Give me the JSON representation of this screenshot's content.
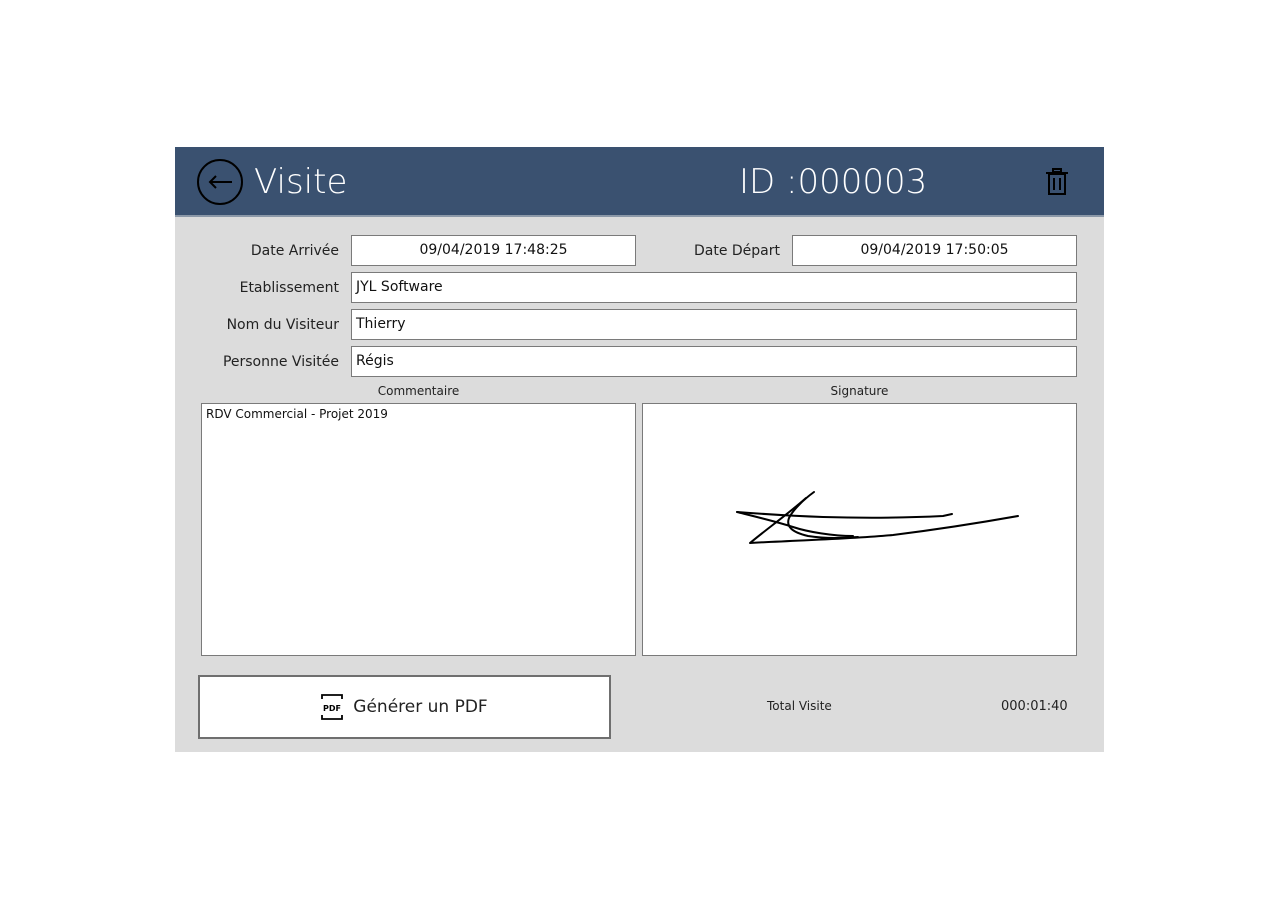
{
  "header": {
    "title": "Visite",
    "id_text": "ID :000003",
    "back_icon": "arrow-left-icon",
    "delete_icon": "trash-icon"
  },
  "form": {
    "date_arrivee_label": "Date Arrivée",
    "date_arrivee_value": "09/04/2019 17:48:25",
    "date_depart_label": "Date Départ",
    "date_depart_value": "09/04/2019 17:50:05",
    "etablissement_label": "Etablissement",
    "etablissement_value": "JYL Software",
    "visiteur_label": "Nom du Visiteur",
    "visiteur_value": "Thierry",
    "personne_label": "Personne Visitée",
    "personne_value": "Régis"
  },
  "commentaire": {
    "title": "Commentaire",
    "text": "RDV Commercial - Projet 2019"
  },
  "signature": {
    "title": "Signature"
  },
  "footer": {
    "pdf_button_label": "Générer un PDF",
    "pdf_icon": "pdf-icon",
    "pdf_icon_text": "PDF",
    "total_label": "Total Visite",
    "total_value": "000:01:40"
  },
  "colors": {
    "header_bg": "#3a5170",
    "body_bg": "#dcdcdc"
  }
}
